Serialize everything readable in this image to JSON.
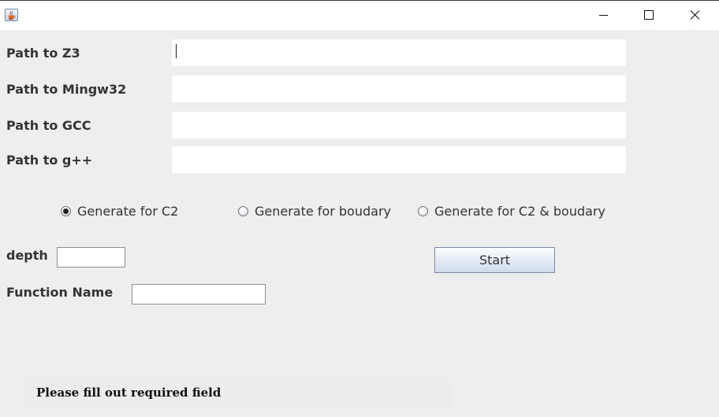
{
  "window": {
    "app_icon": "java-coffee-cup-icon",
    "controls": [
      "minimize-icon",
      "maximize-icon",
      "close-icon"
    ]
  },
  "form": {
    "z3_label": "Path to Z3",
    "mingw_label": "Path to Mingw32",
    "gcc_label": "Path to GCC",
    "gpp_label": "Path to g++",
    "z3_value": "",
    "mingw_value": "",
    "gcc_value": "",
    "gpp_value": ""
  },
  "options": {
    "items": [
      {
        "label": "Generate for C2",
        "checked": true
      },
      {
        "label": "Generate for boudary",
        "checked": false
      },
      {
        "label": "Generate for C2 & boudary",
        "checked": false
      }
    ]
  },
  "params": {
    "depth_label": "depth",
    "depth_value": "",
    "function_label": "Function Name",
    "function_value": ""
  },
  "actions": {
    "start_label": "Start"
  },
  "status": {
    "message": "Please fill out required field"
  },
  "colors": {
    "window_bg": "#eeeeee",
    "field_bg": "#ffffff",
    "label_text": "#333333"
  }
}
